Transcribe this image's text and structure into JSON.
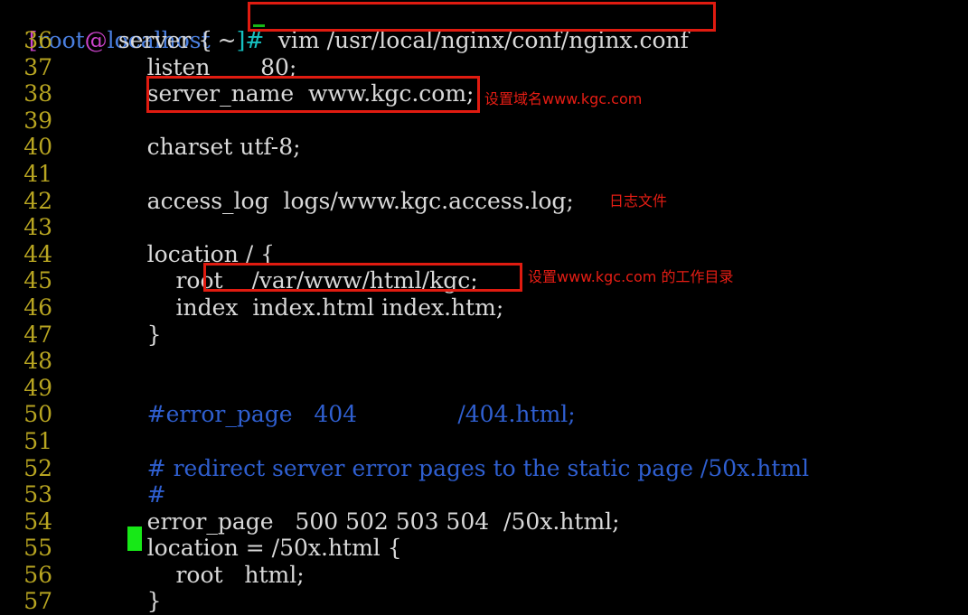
{
  "terminal": {
    "background": "#000000",
    "prompt": {
      "open_bracket": "[",
      "user": "root",
      "at": "@",
      "host": "localhost",
      "path": " ~",
      "close": "]#",
      "command": "vim /usr/local/nginx/conf/nginx.conf"
    },
    "colors": {
      "line_number": "#b8a521",
      "text": "#d9d9d9",
      "comment": "#2f5fd0",
      "cursor": "#17e817",
      "annotation": "#e61d14",
      "box_border": "#e01b10",
      "prompt_user": "#4a7fe0",
      "prompt_bracket": "#cc44cc",
      "prompt_end": "#16c1c1"
    },
    "lines": [
      {
        "number": "36",
        "text": "  server {",
        "style": "text"
      },
      {
        "number": "37",
        "text": "      listen       80;",
        "style": "text"
      },
      {
        "number": "38",
        "text": "      server_name  www.kgc.com;",
        "style": "text"
      },
      {
        "number": "39",
        "text": "",
        "style": "text"
      },
      {
        "number": "40",
        "text": "      charset utf-8;",
        "style": "text"
      },
      {
        "number": "41",
        "text": "",
        "style": "text"
      },
      {
        "number": "42",
        "text": "      access_log  logs/www.kgc.access.log;",
        "style": "text"
      },
      {
        "number": "43",
        "text": "",
        "style": "text"
      },
      {
        "number": "44",
        "text": "      location / {",
        "style": "text"
      },
      {
        "number": "45",
        "text": "          root    /var/www/html/kgc;",
        "style": "text"
      },
      {
        "number": "46",
        "text": "          index  index.html index.htm;",
        "style": "text"
      },
      {
        "number": "47",
        "text": "      }",
        "style": "text"
      },
      {
        "number": "48",
        "text": "",
        "style": "text"
      },
      {
        "number": "49",
        "text": "",
        "style": "text"
      },
      {
        "number": "50",
        "text": "      #error_page   404              /404.html;",
        "style": "comment"
      },
      {
        "number": "51",
        "text": "",
        "style": "text"
      },
      {
        "number": "52",
        "text": "      # redirect server error pages to the static page /50x.html",
        "style": "comment"
      },
      {
        "number": "53",
        "text": "      #",
        "style": "comment"
      },
      {
        "number": "54",
        "text": "      error_page   500 502 503 504  /50x.html;",
        "style": "text"
      },
      {
        "number": "55",
        "text": "      location = /50x.html {",
        "style": "text"
      },
      {
        "number": "56",
        "text": "          root   html;",
        "style": "text"
      },
      {
        "number": "57",
        "text": "      }",
        "style": "text"
      }
    ],
    "annotations": [
      {
        "id": "annot-server-name",
        "text": "设置域名www.kgc.com"
      },
      {
        "id": "annot-access-log",
        "text": "日志文件"
      },
      {
        "id": "annot-root-dir",
        "text": "设置www.kgc.com 的工作目录"
      }
    ],
    "highlight_boxes": [
      {
        "id": "box-vim-command"
      },
      {
        "id": "box-server-name"
      },
      {
        "id": "box-root-directive"
      }
    ]
  }
}
